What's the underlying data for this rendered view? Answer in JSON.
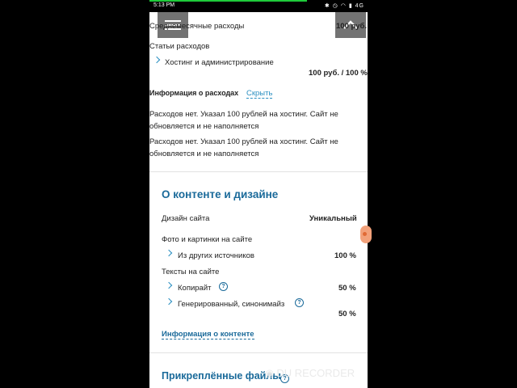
{
  "status_bar": {
    "time": "5:13 PM",
    "network": "4G",
    "icons": [
      "bluetooth-icon",
      "alarm-icon",
      "wifi-icon",
      "signal-icon"
    ]
  },
  "expenses": {
    "monthly_label": "Среднемесячные расходы",
    "monthly_value": "100 руб.",
    "items_label": "Статьи расходов",
    "item_label": "Хостинг и администрирование",
    "item_value": "100 руб. / 100 %",
    "info_label": "Информация о расходах",
    "hide_link": "Скрыть",
    "para1_line1": "Расходов нет. Указал 100 рублей на хостинг. Сайт не",
    "para1_line2": "обновляется и не наполняется",
    "para2_line1": "Расходов нет. Указал 100 рублей на хостинг. Сайт не",
    "para2_line2": "обновляется и не наполняется"
  },
  "content_design": {
    "title": "О контенте и дизайне",
    "design_label": "Дизайн сайта",
    "design_value": "Уникальный",
    "photos_label": "Фото и картинки на сайте",
    "photos_item": "Из других источников",
    "photos_value": "100 %",
    "texts_label": "Тексты на сайте",
    "copyright_label": "Копирайт",
    "copyright_value": "50 %",
    "generated_label": "Генерированный, синонимайз",
    "generated_value": "50 %",
    "info_link": "Информация о контенте",
    "help_glyph": "?"
  },
  "attached": {
    "title": "Прикреплённые файлы"
  },
  "recorder": {
    "label": "DU RECORDER"
  },
  "colors": {
    "accent": "#1a6a9a",
    "link": "#2a8fc1",
    "status_progress": "#1ecb3a"
  }
}
